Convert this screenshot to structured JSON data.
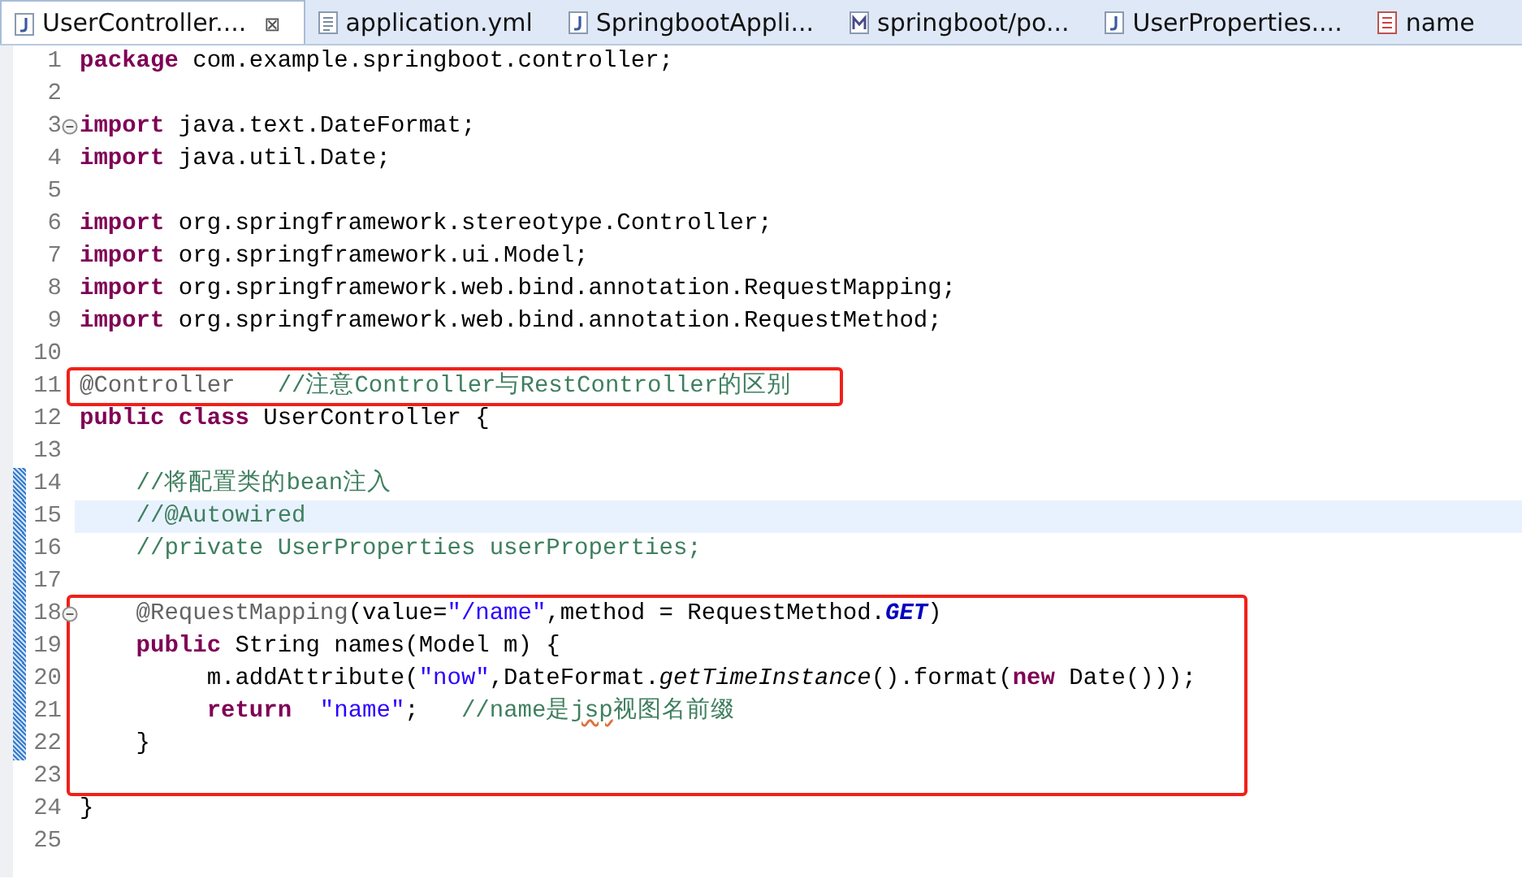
{
  "tabs": [
    {
      "label": "UserController....",
      "kind": "java",
      "selected": true,
      "closable": true
    },
    {
      "label": "application.yml",
      "kind": "text",
      "selected": false
    },
    {
      "label": "SpringbootAppli...",
      "kind": "java",
      "selected": false
    },
    {
      "label": "springboot/po...",
      "kind": "maven",
      "selected": false
    },
    {
      "label": "UserProperties....",
      "kind": "java",
      "selected": false
    },
    {
      "label": "name",
      "kind": "page",
      "selected": false
    }
  ],
  "close_glyph": "⊠",
  "blocks": [
    {
      "lines": [
        {
          "number": "1",
          "tokens": [
            {
              "kind": "keyword",
              "text": "package"
            },
            {
              "kind": "plain",
              "text": " com.example.springboot.controller;"
            }
          ]
        },
        {
          "number": "2"
        },
        {
          "number": "3",
          "foldable": true,
          "tokens": [
            {
              "kind": "keyword",
              "text": "import"
            },
            {
              "kind": "plain",
              "text": " java.text.DateFormat;"
            }
          ]
        },
        {
          "number": "4",
          "tokens": [
            {
              "kind": "keyword",
              "text": "import"
            },
            {
              "kind": "plain",
              "text": " java.util.Date;"
            }
          ]
        },
        {
          "number": "5"
        },
        {
          "number": "6",
          "tokens": [
            {
              "kind": "keyword",
              "text": "import"
            },
            {
              "kind": "plain",
              "text": " org.springframework.stereotype.Controller;"
            }
          ]
        },
        {
          "number": "7",
          "tokens": [
            {
              "kind": "keyword",
              "text": "import"
            },
            {
              "kind": "plain",
              "text": " org.springframework.ui.Model;"
            }
          ]
        },
        {
          "number": "8",
          "tokens": [
            {
              "kind": "keyword",
              "text": "import"
            },
            {
              "kind": "plain",
              "text": " org.springframework.web.bind.annotation.RequestMapping;"
            }
          ]
        },
        {
          "number": "9",
          "tokens": [
            {
              "kind": "keyword",
              "text": "import"
            },
            {
              "kind": "plain",
              "text": " org.springframework.web.bind.annotation.RequestMethod;"
            }
          ]
        },
        {
          "number": "10"
        }
      ]
    },
    {
      "boxed": true,
      "lines": [
        {
          "number": "11",
          "tokens": [
            {
              "kind": "annotation",
              "text": "@Controller   "
            },
            {
              "kind": "comment",
              "text": "//注意Controller与RestController的区别"
            }
          ]
        }
      ]
    },
    {
      "lines": [
        {
          "number": "12",
          "tokens": [
            {
              "kind": "keyword",
              "text": "public"
            },
            {
              "kind": "keyword",
              "text": " class"
            },
            {
              "kind": "plain",
              "text": " UserController {"
            }
          ]
        },
        {
          "number": "13"
        },
        {
          "number": "14",
          "changed": true,
          "tokens": [
            {
              "kind": "comment",
              "text": "    //将配置类的bean注入"
            }
          ]
        },
        {
          "number": "15",
          "changed": true,
          "current": true,
          "tokens": [
            {
              "kind": "comment",
              "text": "    //@Autowired"
            }
          ]
        },
        {
          "number": "16",
          "changed": true,
          "tokens": [
            {
              "kind": "comment",
              "text": "    //private UserProperties userProperties;"
            }
          ]
        },
        {
          "number": "17",
          "changed": true
        }
      ]
    },
    {
      "boxed": true,
      "lines": [
        {
          "number": "18",
          "foldable": true,
          "changed": true,
          "tokens": [
            {
              "kind": "annotation",
              "text": "    @RequestMapping"
            },
            {
              "kind": "plain",
              "text": "(value="
            },
            {
              "kind": "string",
              "text": "\"/name\""
            },
            {
              "kind": "plain",
              "text": ",method = RequestMethod."
            },
            {
              "kind": "constant",
              "text": "GET"
            },
            {
              "kind": "plain",
              "text": ")"
            }
          ]
        },
        {
          "number": "19",
          "changed": true,
          "tokens": [
            {
              "kind": "keyword",
              "text": "    public"
            },
            {
              "kind": "plain",
              "text": " String names(Model m) {"
            }
          ]
        },
        {
          "number": "20",
          "changed": true,
          "tokens": [
            {
              "kind": "plain",
              "text": "         m.addAttribute("
            },
            {
              "kind": "string",
              "text": "\"now\""
            },
            {
              "kind": "plain",
              "text": ",DateFormat."
            },
            {
              "kind": "static",
              "text": "getTimeInstance"
            },
            {
              "kind": "plain",
              "text": "().format("
            },
            {
              "kind": "keyword",
              "text": "new"
            },
            {
              "kind": "plain",
              "text": " Date()));"
            }
          ]
        },
        {
          "number": "21",
          "changed": true,
          "tokens": [
            {
              "kind": "keyword",
              "text": "         return"
            },
            {
              "kind": "string",
              "text": "  \"name\""
            },
            {
              "kind": "plain",
              "text": ";   "
            },
            {
              "kind": "comment",
              "text": "//name是"
            },
            {
              "kind": "misspelled",
              "text": "jsp"
            },
            {
              "kind": "comment",
              "text": "视图名前缀"
            }
          ]
        },
        {
          "number": "22",
          "changed": true,
          "tokens": [
            {
              "kind": "plain",
              "text": "    }"
            }
          ]
        },
        {
          "number": "23"
        }
      ]
    },
    {
      "lines": [
        {
          "number": "24",
          "tokens": [
            {
              "kind": "plain",
              "text": "}"
            }
          ]
        },
        {
          "number": "25"
        }
      ]
    }
  ]
}
